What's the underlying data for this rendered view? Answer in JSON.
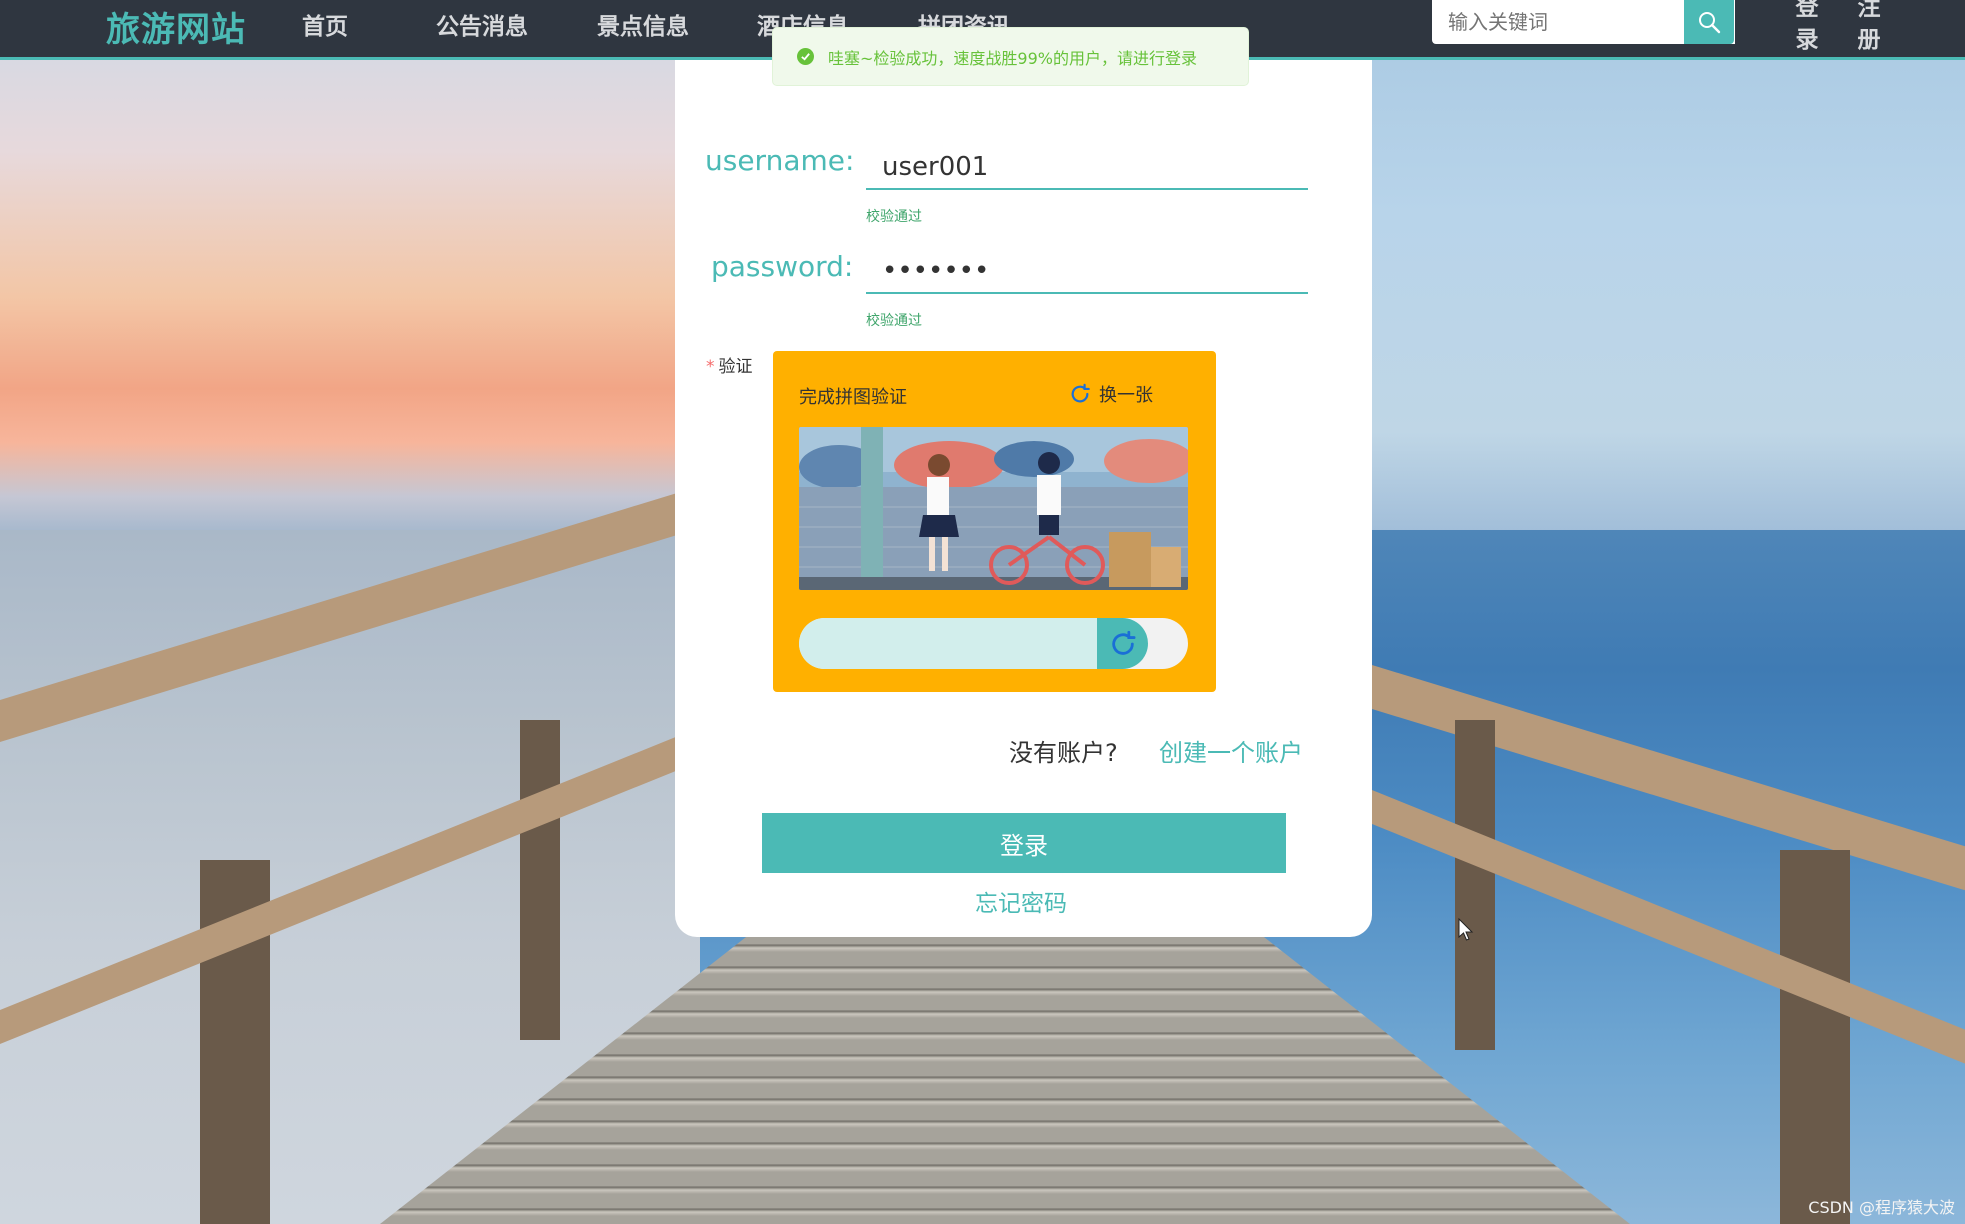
{
  "header": {
    "brand": "旅游网站",
    "nav": [
      "首页",
      "公告消息",
      "景点信息",
      "酒店信息",
      "拼团资讯"
    ],
    "search": {
      "placeholder": "输入关键词"
    },
    "auth": {
      "login": "登录",
      "register": "注册"
    }
  },
  "toast": {
    "message": "哇塞~检验成功，速度战胜99%的用户，请进行登录"
  },
  "form": {
    "username_label": "username:",
    "username_value": "user001",
    "username_hint": "校验通过",
    "password_label": "password:",
    "password_value": "user001",
    "password_hint": "校验通过",
    "verify_label": "验证",
    "captcha": {
      "title": "完成拼图验证",
      "refresh_label": "换一张",
      "slider_progress_percent": 78
    },
    "no_account": "没有账户?",
    "create_account": "创建一个账户",
    "login_button": "登录",
    "forgot_password": "忘记密码"
  },
  "watermark": "CSDN @程序猿大波",
  "colors": {
    "accent": "#4bbab5",
    "topbar": "#2f3640",
    "captcha_bg": "#ffb000",
    "success": "#67c23a"
  }
}
